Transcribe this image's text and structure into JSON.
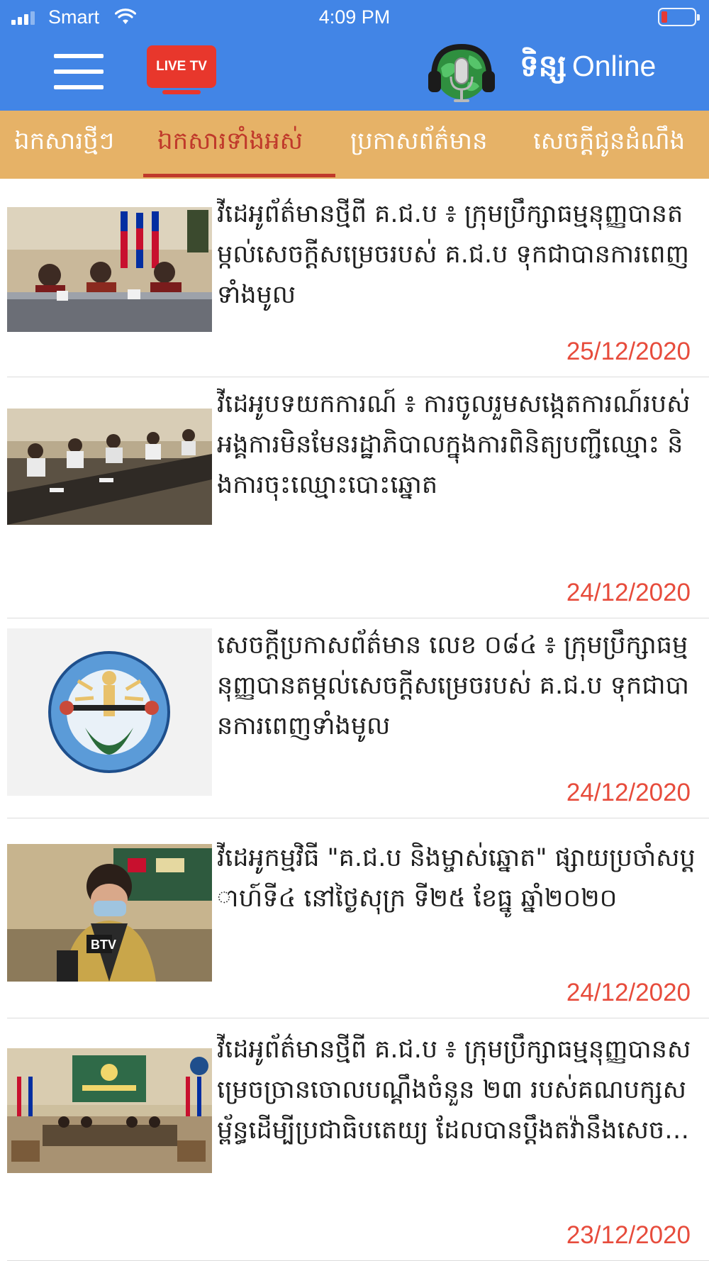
{
  "status_bar": {
    "carrier": "Smart",
    "time": "4:09 PM",
    "battery_color": "#e53935"
  },
  "header": {
    "background_color": "#4285e6",
    "menu_icon": "hamburger-menu-icon",
    "live_tv_label": "LIVE TV",
    "logo_icon": "microphone-headphones-globe-icon",
    "brand_khmer": "ទិន្ស",
    "brand_latin": "Online"
  },
  "tabs": {
    "background_color": "#e6b267",
    "active_color": "#c0392b",
    "items": [
      {
        "label": "ឯកសារថ្មីៗ",
        "active": false
      },
      {
        "label": "ឯកសារទាំងអស់",
        "active": true
      },
      {
        "label": "ប្រកាសព័ត៌មាន",
        "active": false
      },
      {
        "label": "សេចក្ដីជូនដំណឹង",
        "active": false
      }
    ]
  },
  "articles": [
    {
      "title": "វីដេអូព័ត៌មានថ្មីពី គ.ជ.ប ៖ ក្រុមប្រឹក្សាធម្មនុញ្ញបានតម្កល់សេចក្ដីសម្រេចរបស់ គ.ជ.ប ទុកជាបានការពេញទាំងមូល",
      "date": "25/12/2020",
      "thumbnail": "meeting-photo"
    },
    {
      "title": "វីដេអូបទយកការណ៍ ៖ ការចូលរួមសង្កេតការណ៍របស់អង្គការមិនមែនរដ្ឋាភិបាលក្នុងការពិនិត្យបញ្ជីឈ្មោះ និងការចុះឈ្មោះបោះឆ្នោត",
      "date": "24/12/2020",
      "thumbnail": "conference-table-photo"
    },
    {
      "title": "សេចក្ដីប្រកាសព័ត៌មាន លេខ ០៨៤ ៖ ក្រុមប្រឹក្សាធម្មនុញ្ញបានតម្កល់សេចក្ដីសម្រេចរបស់  គ.ជ.ប ទុកជាបានការពេញទាំងមូល",
      "date": "24/12/2020",
      "thumbnail": "nec-emblem"
    },
    {
      "title": "វីដេអូកម្មវិធី \"គ.ជ.ប និងម្ចាស់ឆ្នោត\" ផ្សាយប្រចាំសប្ដាហ៍ទី៤ នៅថ្ងៃសុក្រ ទី២៥ ខែធ្នូ ឆ្នាំ២០២០",
      "date": "24/12/2020",
      "thumbnail": "interview-photo"
    },
    {
      "title": "វីដេអូព័ត៌មានថ្មីពី គ.ជ.ប ៖ ក្រុមប្រឹក្សាធម្មនុញ្ញបានសម្រេចច្រានចោលបណ្ដឹងចំនួន ២៣ របស់គណបក្សសម្ព័ន្ធដើម្បីប្រជាធិបតេយ្យ ដែលបានប្ដឹងតវ៉ានឹងសេច…",
      "date": "23/12/2020",
      "thumbnail": "hearing-room-photo"
    }
  ],
  "date_color": "#e74c3c"
}
